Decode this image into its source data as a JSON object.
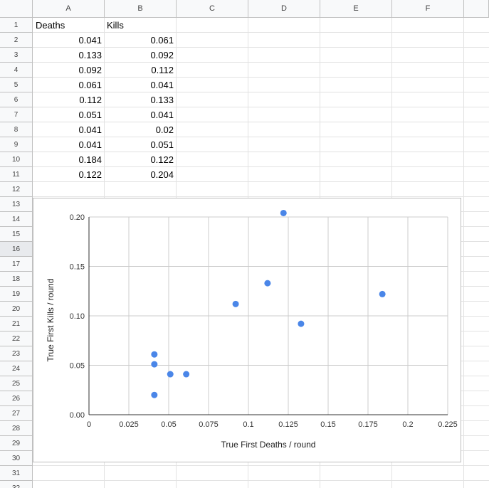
{
  "columns": [
    "A",
    "B",
    "C",
    "D",
    "E",
    "F"
  ],
  "rows": [
    "1",
    "2",
    "3",
    "4",
    "5",
    "6",
    "7",
    "8",
    "9",
    "10",
    "11",
    "12",
    "13",
    "14",
    "15",
    "16",
    "17",
    "18",
    "19",
    "20",
    "21",
    "22",
    "23",
    "24",
    "25",
    "26",
    "27",
    "28",
    "29",
    "30",
    "31",
    "32"
  ],
  "selected_row": "16",
  "table": {
    "headers": [
      "Deaths",
      "Kills"
    ],
    "deaths": [
      "0.041",
      "0.133",
      "0.092",
      "0.061",
      "0.112",
      "0.051",
      "0.041",
      "0.041",
      "0.184",
      "0.122"
    ],
    "kills": [
      "0.061",
      "0.092",
      "0.112",
      "0.041",
      "0.133",
      "0.041",
      "0.02",
      "0.051",
      "0.122",
      "0.204"
    ]
  },
  "colors": {
    "point": "#4a86e8",
    "grid": "#cccccc",
    "axis": "#333333"
  },
  "chart_data": {
    "type": "scatter",
    "title": "",
    "xlabel": "True First Deaths / round",
    "ylabel": "True First Kills / round",
    "xlim": [
      0,
      0.225
    ],
    "ylim": [
      0,
      0.2
    ],
    "x_ticks": [
      "0",
      "0.025",
      "0.05",
      "0.075",
      "0.1",
      "0.125",
      "0.15",
      "0.175",
      "0.2",
      "0.225"
    ],
    "y_ticks": [
      "0.00",
      "0.05",
      "0.10",
      "0.15",
      "0.20"
    ],
    "legend": "none",
    "grid": true,
    "points": [
      {
        "x": 0.041,
        "y": 0.061
      },
      {
        "x": 0.133,
        "y": 0.092
      },
      {
        "x": 0.092,
        "y": 0.112
      },
      {
        "x": 0.061,
        "y": 0.041
      },
      {
        "x": 0.112,
        "y": 0.133
      },
      {
        "x": 0.051,
        "y": 0.041
      },
      {
        "x": 0.041,
        "y": 0.02
      },
      {
        "x": 0.041,
        "y": 0.051
      },
      {
        "x": 0.184,
        "y": 0.122
      },
      {
        "x": 0.122,
        "y": 0.204
      }
    ]
  }
}
